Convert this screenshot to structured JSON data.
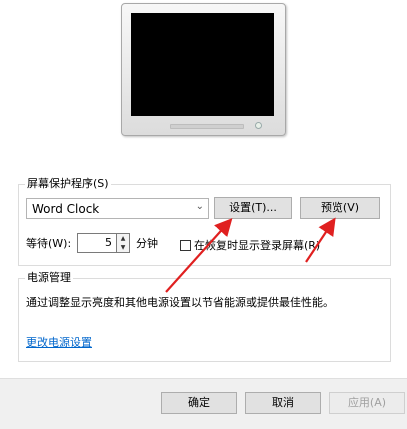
{
  "screensaver": {
    "group_title": "屏幕保护程序(S)",
    "selected": "Word Clock",
    "settings_label": "设置(T)...",
    "preview_label": "预览(V)",
    "wait_label": "等待(W):",
    "wait_value": "5",
    "minutes_label": "分钟",
    "resume_checkbox_label": "在恢复时显示登录屏幕(R)",
    "resume_checked": false
  },
  "power": {
    "group_title": "电源管理",
    "description": "通过调整显示亮度和其他电源设置以节省能源或提供最佳性能。",
    "link_label": "更改电源设置"
  },
  "footer": {
    "ok_label": "确定",
    "cancel_label": "取消",
    "apply_label": "应用(A)"
  },
  "annotations": {
    "arrow_color": "#e02020"
  }
}
